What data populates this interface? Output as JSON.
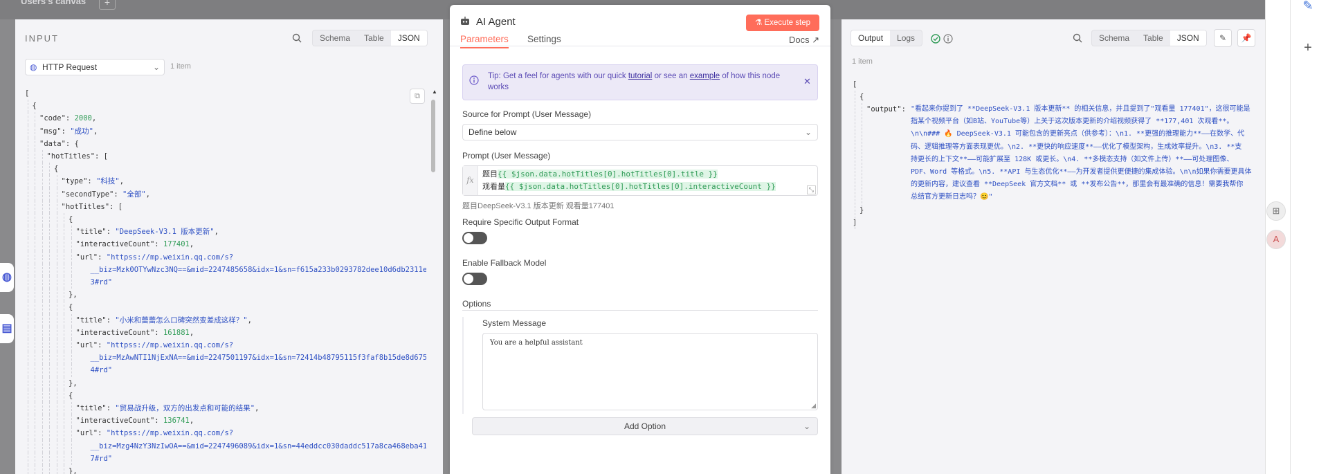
{
  "background": {
    "canvas_title": "Users's canvas"
  },
  "input": {
    "title": "INPUT",
    "tabs": [
      "Schema",
      "Table",
      "JSON"
    ],
    "active_tab": "JSON",
    "node_select": "HTTP Request",
    "item_count": "1 item",
    "json_lines": [
      {
        "indent": 0,
        "parts": [
          {
            "t": "p",
            "v": "["
          }
        ]
      },
      {
        "indent": 1,
        "parts": [
          {
            "t": "p",
            "v": "{"
          }
        ]
      },
      {
        "indent": 2,
        "parts": [
          {
            "t": "k",
            "v": "\"code\": "
          },
          {
            "t": "n",
            "v": "2000"
          },
          {
            "t": "p",
            "v": ","
          }
        ]
      },
      {
        "indent": 2,
        "parts": [
          {
            "t": "k",
            "v": "\"msg\": "
          },
          {
            "t": "s",
            "v": "\"成功\""
          },
          {
            "t": "p",
            "v": ","
          }
        ]
      },
      {
        "indent": 2,
        "parts": [
          {
            "t": "k",
            "v": "\"data\": {"
          }
        ]
      },
      {
        "indent": 3,
        "parts": [
          {
            "t": "k",
            "v": "\"hotTitles\": ["
          }
        ]
      },
      {
        "indent": 4,
        "parts": [
          {
            "t": "p",
            "v": "{"
          }
        ]
      },
      {
        "indent": 5,
        "parts": [
          {
            "t": "k",
            "v": "\"type\": "
          },
          {
            "t": "s",
            "v": "\"科技\""
          },
          {
            "t": "p",
            "v": ","
          }
        ]
      },
      {
        "indent": 5,
        "parts": [
          {
            "t": "k",
            "v": "\"secondType\": "
          },
          {
            "t": "s",
            "v": "\"全部\""
          },
          {
            "t": "p",
            "v": ","
          }
        ]
      },
      {
        "indent": 5,
        "parts": [
          {
            "t": "k",
            "v": "\"hotTitles\": ["
          }
        ]
      },
      {
        "indent": 6,
        "parts": [
          {
            "t": "p",
            "v": "{"
          }
        ]
      },
      {
        "indent": 7,
        "parts": [
          {
            "t": "k",
            "v": "\"title\": "
          },
          {
            "t": "s",
            "v": "\"DeepSeek-V3.1 版本更新\""
          },
          {
            "t": "p",
            "v": ","
          }
        ]
      },
      {
        "indent": 7,
        "parts": [
          {
            "t": "k",
            "v": "\"interactiveCount\": "
          },
          {
            "t": "n",
            "v": "177401"
          },
          {
            "t": "p",
            "v": ","
          }
        ]
      },
      {
        "indent": 7,
        "parts": [
          {
            "t": "k",
            "v": "\"url\": "
          },
          {
            "t": "s",
            "v": "\"httpss://mp.weixin.qq.com/s?"
          }
        ]
      },
      {
        "indent": 9,
        "parts": [
          {
            "t": "s",
            "v": "__biz=Mzk0OTYwNzc3NQ==&mid=2247485658&idx=1&sn=f615a233b0293782dee10d6db2311e2"
          }
        ]
      },
      {
        "indent": 9,
        "parts": [
          {
            "t": "s",
            "v": "3#rd\""
          }
        ]
      },
      {
        "indent": 6,
        "parts": [
          {
            "t": "p",
            "v": "},"
          }
        ]
      },
      {
        "indent": 6,
        "parts": [
          {
            "t": "p",
            "v": "{"
          }
        ]
      },
      {
        "indent": 7,
        "parts": [
          {
            "t": "k",
            "v": "\"title\": "
          },
          {
            "t": "s",
            "v": "\"小米和蕾蕾怎么口碑突然变差成这样？\""
          },
          {
            "t": "p",
            "v": ","
          }
        ]
      },
      {
        "indent": 7,
        "parts": [
          {
            "t": "k",
            "v": "\"interactiveCount\": "
          },
          {
            "t": "n",
            "v": "161881"
          },
          {
            "t": "p",
            "v": ","
          }
        ]
      },
      {
        "indent": 7,
        "parts": [
          {
            "t": "k",
            "v": "\"url\": "
          },
          {
            "t": "s",
            "v": "\"httpss://mp.weixin.qq.com/s?"
          }
        ]
      },
      {
        "indent": 9,
        "parts": [
          {
            "t": "s",
            "v": "__biz=MzAwNTI1NjExNA==&mid=2247501197&idx=1&sn=72414b48795115f3faf8b15de8d6756"
          }
        ]
      },
      {
        "indent": 9,
        "parts": [
          {
            "t": "s",
            "v": "4#rd\""
          }
        ]
      },
      {
        "indent": 6,
        "parts": [
          {
            "t": "p",
            "v": "},"
          }
        ]
      },
      {
        "indent": 6,
        "parts": [
          {
            "t": "p",
            "v": "{"
          }
        ]
      },
      {
        "indent": 7,
        "parts": [
          {
            "t": "k",
            "v": "\"title\": "
          },
          {
            "t": "s",
            "v": "\"贸易战升级，双方的出发点和可能的结果\""
          },
          {
            "t": "p",
            "v": ","
          }
        ]
      },
      {
        "indent": 7,
        "parts": [
          {
            "t": "k",
            "v": "\"interactiveCount\": "
          },
          {
            "t": "n",
            "v": "136741"
          },
          {
            "t": "p",
            "v": ","
          }
        ]
      },
      {
        "indent": 7,
        "parts": [
          {
            "t": "k",
            "v": "\"url\": "
          },
          {
            "t": "s",
            "v": "\"httpss://mp.weixin.qq.com/s?"
          }
        ]
      },
      {
        "indent": 9,
        "parts": [
          {
            "t": "s",
            "v": "__biz=Mzg4NzY3NzIwOA==&mid=2247496089&idx=1&sn=44eddcc030daddc517a8ca468eba419"
          }
        ]
      },
      {
        "indent": 9,
        "parts": [
          {
            "t": "s",
            "v": "7#rd\""
          }
        ]
      },
      {
        "indent": 6,
        "parts": [
          {
            "t": "p",
            "v": "},"
          }
        ]
      }
    ]
  },
  "node": {
    "title": "AI Agent",
    "execute_label": "Execute step",
    "tabs": [
      "Parameters",
      "Settings"
    ],
    "docs_label": "Docs",
    "tip": {
      "prefix": "Tip: Get a feel for agents with our quick ",
      "link1": "tutorial",
      "middle": " or see an ",
      "link2": "example",
      "suffix": " of how this node works"
    },
    "source_label": "Source for Prompt (User Message)",
    "source_value": "Define below",
    "prompt_label": "Prompt (User Message)",
    "fx": "fx",
    "prompt_line1_text": "题目",
    "prompt_line1_expr": "{{ $json.data.hotTitles[0].hotTitles[0].title }}",
    "prompt_line2_text": "观看量",
    "prompt_line2_expr": "{{ $json.data.hotTitles[0].hotTitles[0].interactiveCount }}",
    "prompt_preview": "题目DeepSeek-V3.1 版本更新 观看量177401",
    "output_format_label": "Require Specific Output Format",
    "fallback_label": "Enable Fallback Model",
    "options_label": "Options",
    "system_message_label": "System Message",
    "system_message_value": "You are a helpful assistant",
    "add_option_label": "Add Option"
  },
  "output": {
    "tabs": [
      "Output",
      "Logs"
    ],
    "active_tab": "Output",
    "view_tabs": [
      "Schema",
      "Table",
      "JSON"
    ],
    "active_view": "JSON",
    "item_count": "1 item",
    "open_bracket": "[",
    "open_brace": "{",
    "key": "\"output\": ",
    "text_lines": [
      "\"看起来你提到了 **DeepSeek-V3.1 版本更新** 的相关信息，并且提到了\"观看量 177401\"，这很可能是",
      "指某个视频平台（如B站、YouTube等）上关于这次版本更新的介绍视频获得了 **177,401 次观看**。",
      "\\n\\n### 🔥 DeepSeek-V3.1 可能包含的更新亮点（供参考）：\\n1. **更强的推理能力**——在数学、代",
      "码、逻辑推理等方面表现更优。\\n2. **更快的响应速度**——优化了模型架构，生成效率提升。\\n3. **支",
      "持更长的上下文**——可能扩展至 128K 或更长。\\n4. **多模态支持（如文件上传）**——可处理图像、",
      "PDF、Word 等格式。\\n5. **API 与生态优化**——为开发者提供更便捷的集成体验。\\n\\n如果你需要更具体",
      "的更新内容，建议查看 **DeepSeek 官方文档** 或 **发布公告**，那里会有最准确的信息！需要我帮你",
      "总结官方更新日志吗？😊\""
    ],
    "close_brace": "}",
    "close_bracket": "]"
  }
}
